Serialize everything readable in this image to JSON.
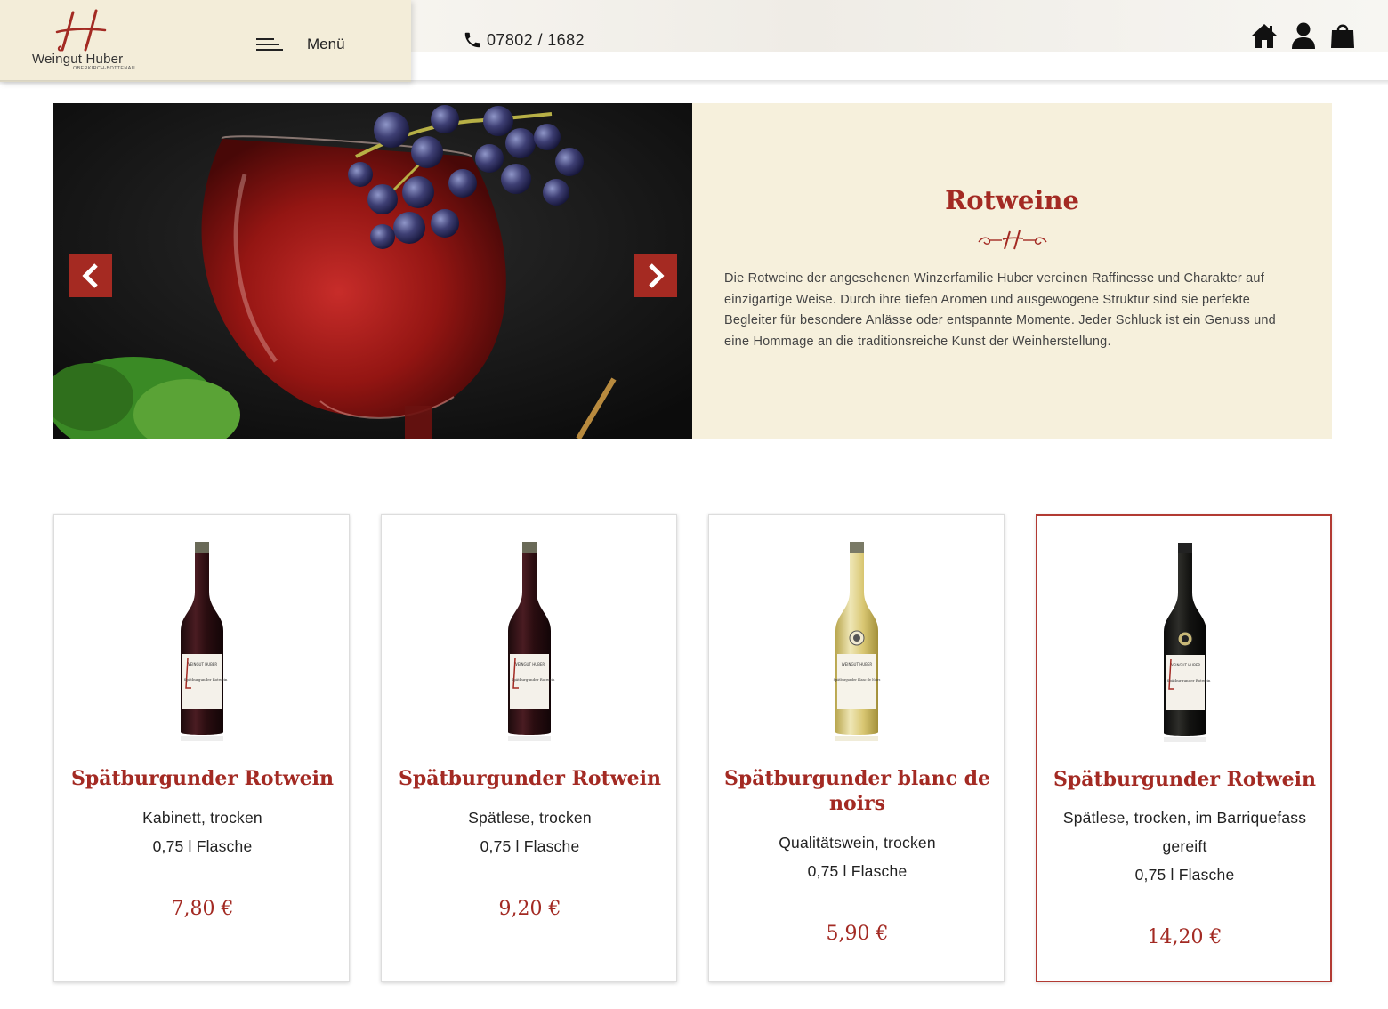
{
  "brand": {
    "name": "Weingut Huber",
    "sub": "OBERKIRCH-BOTTENAU"
  },
  "header": {
    "menu_label": "Menü",
    "phone": "07802 / 1682"
  },
  "hero": {
    "title": "Rotweine",
    "description": "Die Rotweine der angesehenen Winzerfamilie Huber vereinen Raffinesse und Charakter auf einzigartige Weise. Durch ihre tiefen Aromen und ausgewogene Struktur sind sie perfekte Begleiter für besondere Anlässe oder entspannte Momente. Jeder Schluck ist ein Genuss und eine Hommage an die traditionsreiche Kunst der Weinherstellung."
  },
  "products": [
    {
      "name": "Spätburgunder Rotwein",
      "line1": "Kabinett, trocken",
      "line2": "0,75 l Flasche",
      "price": "7,80 €"
    },
    {
      "name": "Spätburgunder Rotwein",
      "line1": "Spätlese, trocken",
      "line2": "0,75 l Flasche",
      "price": "9,20 €"
    },
    {
      "name": "Spätburgunder blanc de noirs",
      "line1": "Qualitätswein, trocken",
      "line2": "0,75 l Flasche",
      "price": "5,90 €"
    },
    {
      "name": "Spätburgunder Rotwein",
      "line1": "Spätlese, trocken, im Barriquefass gereift",
      "line2": "0,75 l Flasche",
      "price": "14,20 €"
    }
  ],
  "bottle_labels": {
    "brand": "WEINGUT HUBER",
    "wine": "Spätburgunder Rotwein",
    "wine_blanc": "Spätburgunder Blanc de Noirs"
  },
  "colors": {
    "accent": "#a32a23",
    "cream": "#f6f0dc",
    "logo_panel": "#f3edd9"
  },
  "icons": [
    "menu-icon",
    "phone-icon",
    "home-icon",
    "user-icon",
    "shopping-bag-icon",
    "chevron-left-icon",
    "chevron-right-icon"
  ]
}
